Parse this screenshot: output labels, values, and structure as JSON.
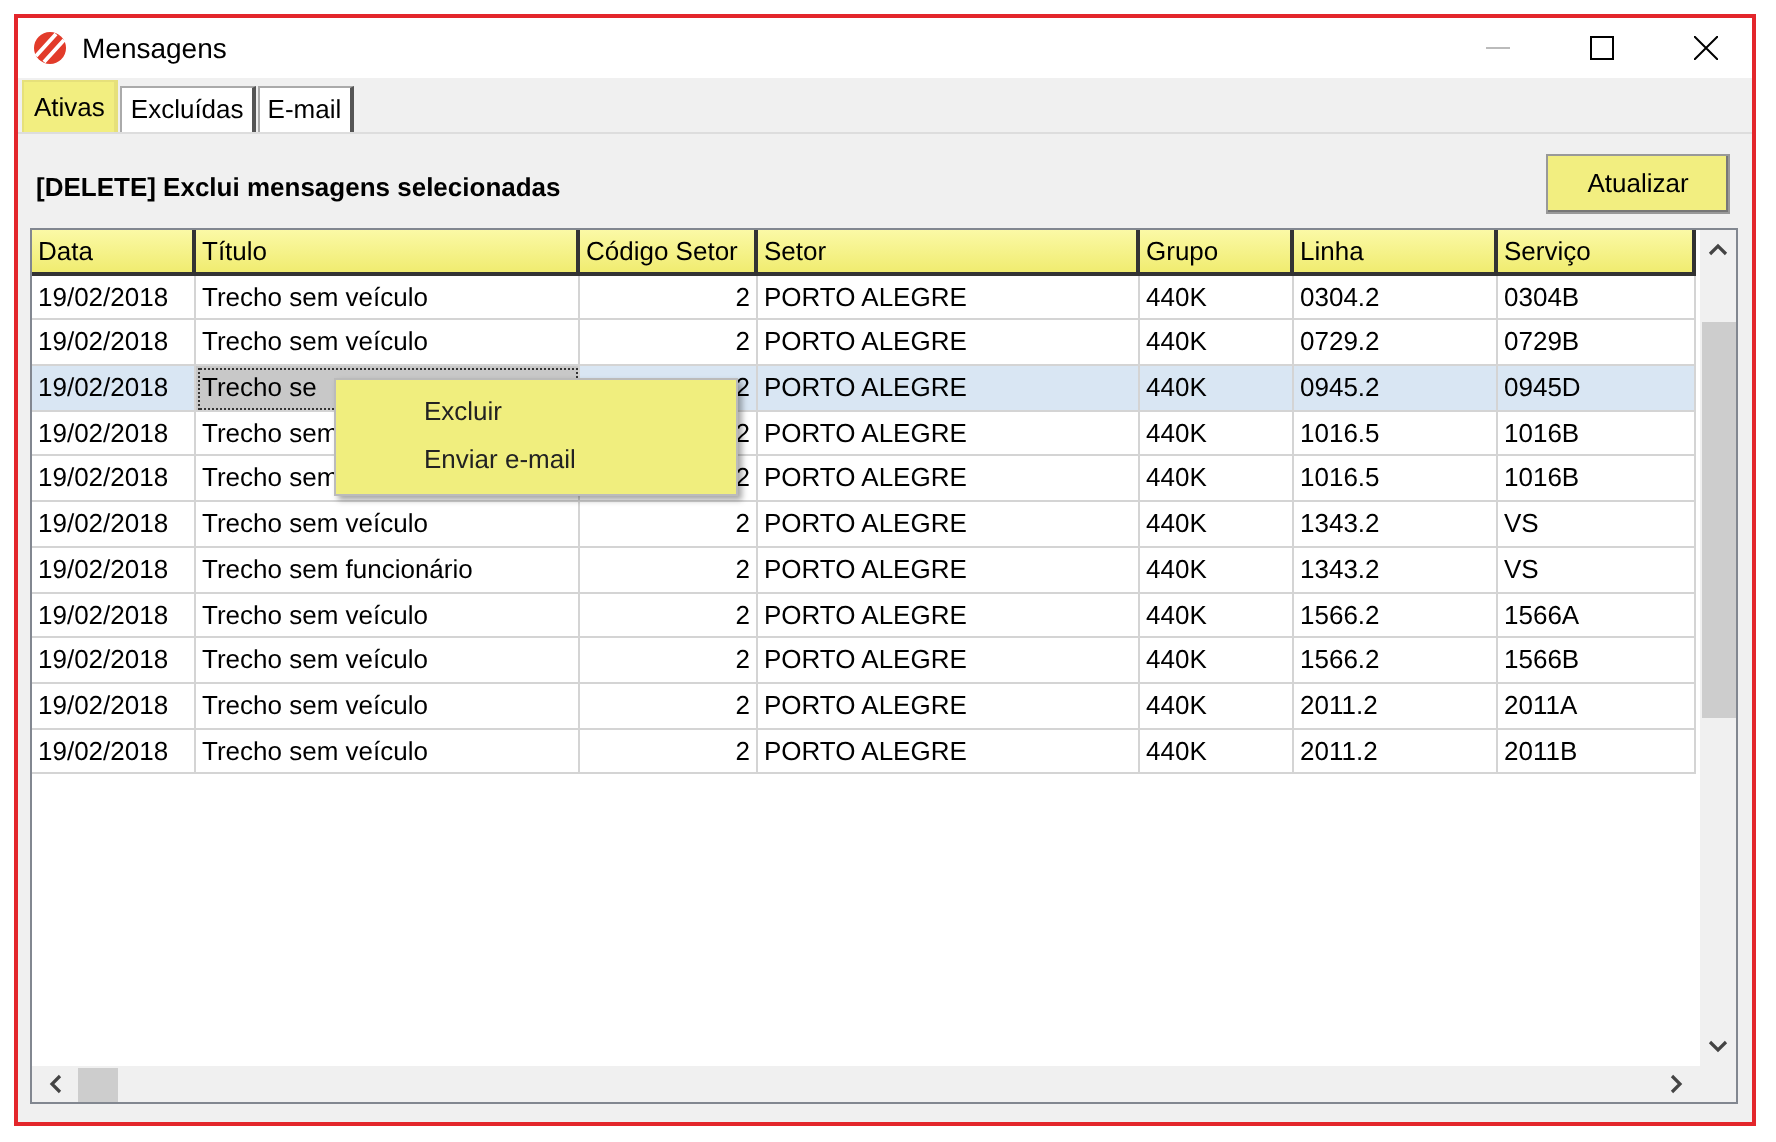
{
  "window": {
    "title": "Mensagens"
  },
  "tabs": [
    {
      "label": "Ativas",
      "selected": true
    },
    {
      "label": "Excluídas",
      "selected": false
    },
    {
      "label": "E-mail",
      "selected": false
    }
  ],
  "hint": "[DELETE] Exclui mensagens selecionadas",
  "refresh_button": "Atualizar",
  "table": {
    "columns": [
      "Data",
      "Título",
      "Código Setor",
      "Setor",
      "Grupo",
      "Linha",
      "Serviço"
    ],
    "rows": [
      {
        "cells": [
          "19/02/2018",
          "Trecho sem veículo",
          "2",
          "PORTO ALEGRE",
          "440K",
          "0304.2",
          "0304B"
        ],
        "selected": false
      },
      {
        "cells": [
          "19/02/2018",
          "Trecho sem veículo",
          "2",
          "PORTO ALEGRE",
          "440K",
          "0729.2",
          "0729B"
        ],
        "selected": false
      },
      {
        "cells": [
          "19/02/2018",
          "Trecho se",
          "2",
          "PORTO ALEGRE",
          "440K",
          "0945.2",
          "0945D"
        ],
        "selected": true
      },
      {
        "cells": [
          "19/02/2018",
          "Trecho sem",
          "2",
          "PORTO ALEGRE",
          "440K",
          "1016.5",
          "1016B"
        ],
        "selected": false
      },
      {
        "cells": [
          "19/02/2018",
          "Trecho sem",
          "2",
          "PORTO ALEGRE",
          "440K",
          "1016.5",
          "1016B"
        ],
        "selected": false
      },
      {
        "cells": [
          "19/02/2018",
          "Trecho sem veículo",
          "2",
          "PORTO ALEGRE",
          "440K",
          "1343.2",
          "VS"
        ],
        "selected": false
      },
      {
        "cells": [
          "19/02/2018",
          "Trecho sem funcionário",
          "2",
          "PORTO ALEGRE",
          "440K",
          "1343.2",
          "VS"
        ],
        "selected": false
      },
      {
        "cells": [
          "19/02/2018",
          "Trecho sem veículo",
          "2",
          "PORTO ALEGRE",
          "440K",
          "1566.2",
          "1566A"
        ],
        "selected": false
      },
      {
        "cells": [
          "19/02/2018",
          "Trecho sem veículo",
          "2",
          "PORTO ALEGRE",
          "440K",
          "1566.2",
          "1566B"
        ],
        "selected": false
      },
      {
        "cells": [
          "19/02/2018",
          "Trecho sem veículo",
          "2",
          "PORTO ALEGRE",
          "440K",
          "2011.2",
          "2011A"
        ],
        "selected": false
      },
      {
        "cells": [
          "19/02/2018",
          "Trecho sem veículo",
          "2",
          "PORTO ALEGRE",
          "440K",
          "2011.2",
          "2011B"
        ],
        "selected": false
      }
    ]
  },
  "context_menu": [
    "Excluir",
    "Enviar e-mail"
  ]
}
